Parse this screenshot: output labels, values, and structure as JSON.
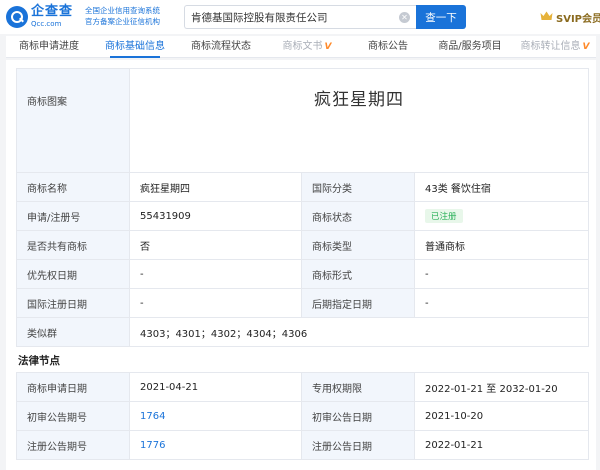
{
  "header": {
    "brand_cn": "企查查",
    "brand_en": "Qcc.com",
    "tagline": [
      "全国企业信用查询系统",
      "官方备案企业征信机构"
    ],
    "search_value": "肯德基国际控股有限责任公司",
    "search_button": "查一下",
    "svip": "SVIP会员",
    "brand_color": "#1a73d9"
  },
  "tabs": [
    {
      "label": "商标申请进度",
      "state": "normal"
    },
    {
      "label": "商标基础信息",
      "state": "active"
    },
    {
      "label": "商标流程状态",
      "state": "normal"
    },
    {
      "label": "商标文书",
      "state": "vip"
    },
    {
      "label": "商标公告",
      "state": "normal"
    },
    {
      "label": "商品/服务项目",
      "state": "normal"
    },
    {
      "label": "商标转让信息",
      "state": "vip"
    }
  ],
  "trademark": {
    "image_label": "商标图案",
    "image_text": "疯狂星期四",
    "rows": [
      {
        "l1": "商标名称",
        "v1": "疯狂星期四",
        "l2": "国际分类",
        "v2": "43类 餐饮住宿"
      },
      {
        "l1": "申请/注册号",
        "v1": "55431909",
        "l2": "商标状态",
        "v2": "已注册"
      },
      {
        "l1": "是否共有商标",
        "v1": "否",
        "l2": "商标类型",
        "v2": "普通商标"
      },
      {
        "l1": "优先权日期",
        "v1": "-",
        "l2": "商标形式",
        "v2": "-"
      },
      {
        "l1": "国际注册日期",
        "v1": "-",
        "l2": "后期指定日期",
        "v2": "-"
      }
    ],
    "similar_label": "类似群",
    "similar_value": "4303；4301；4302；4304；4306",
    "status_color": "#2bb15a"
  },
  "legal": {
    "title": "法律节点",
    "rows": [
      {
        "l1": "商标申请日期",
        "v1": "2021-04-21",
        "l2": "专用权期限",
        "v2": "2022-01-21 至 2032-01-20"
      },
      {
        "l1": "初审公告期号",
        "v1": "1764",
        "l2": "初审公告日期",
        "v2": "2021-10-20"
      },
      {
        "l1": "注册公告期号",
        "v1": "1776",
        "l2": "注册公告日期",
        "v2": "2022-01-21"
      }
    ]
  }
}
